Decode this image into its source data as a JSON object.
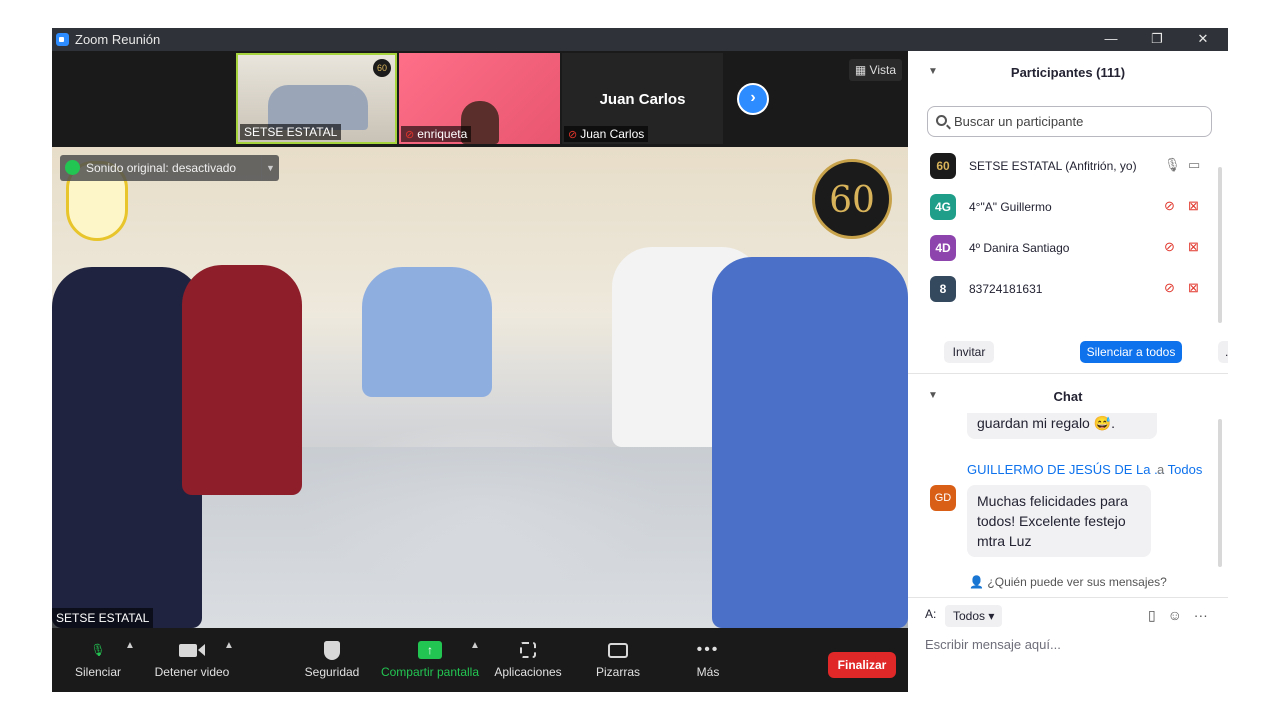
{
  "window": {
    "title": "Zoom Reunión",
    "controls": {
      "minimize": "—",
      "restore": "❐",
      "close": "✕"
    }
  },
  "strip": {
    "thumbnails": [
      {
        "name": "SETSE ESTATAL",
        "muted": false,
        "badge": "60"
      },
      {
        "name": "enriqueta",
        "muted": true
      },
      {
        "name": "Juan Carlos",
        "muted": true,
        "big_name": "Juan Carlos"
      }
    ],
    "next_icon": "chevron-right-icon",
    "view_label": "Vista"
  },
  "main_video": {
    "sound_label": "Sonido original: desactivado",
    "badge": "60",
    "speaker_name": "SETSE ESTATAL"
  },
  "toolbar": {
    "mute": "Silenciar",
    "video": "Detener video",
    "security": "Seguridad",
    "share": "Compartir pantalla",
    "apps": "Aplicaciones",
    "whiteboards": "Pizarras",
    "more": "Más",
    "end": "Finalizar"
  },
  "participants": {
    "title": "Participantes (111)",
    "search_placeholder": "Buscar un participante",
    "list": [
      {
        "avatar": "60",
        "name": "SETSE ESTATAL (Anfitrión, yo)",
        "avatar_color": "#1b1b1b",
        "muted": false
      },
      {
        "avatar": "4G",
        "name": "4°\"A\" Guillermo",
        "avatar_color": "#1f9e89",
        "muted": true
      },
      {
        "avatar": "4D",
        "name": "4º Danira Santiago",
        "avatar_color": "#8e44ad",
        "muted": true
      },
      {
        "avatar": "8",
        "name": "83724181631",
        "avatar_color": "#34495e",
        "muted": true
      }
    ],
    "invite": "Invitar",
    "mute_all": "Silenciar a todos",
    "more": "..."
  },
  "chat": {
    "title": "Chat",
    "messages": [
      {
        "text": "guardan mi regalo 😅."
      },
      {
        "sender": "GUILLERMO DE JESÚS DE La ...",
        "to_prefix": "a",
        "to": "Todos",
        "avatar": "GD",
        "text": "Muchas felicidades para todos!  Excelente festejo mtra Luz"
      }
    ],
    "visibility": "¿Quién puede ver sus mensajes?",
    "to_label": "A:",
    "to_value": "Todos",
    "input_placeholder": "Escribir mensaje aquí..."
  }
}
